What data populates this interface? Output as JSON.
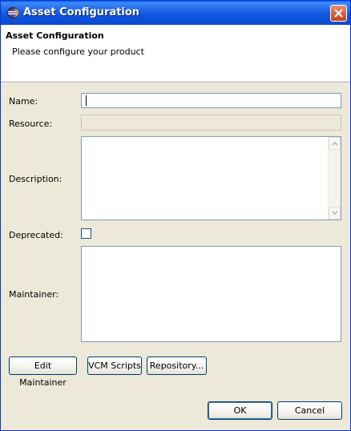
{
  "window": {
    "title": "Asset Configuration",
    "app_icon": "eclipse-icon",
    "close_icon": "close-icon"
  },
  "header": {
    "title": "Asset Configuration",
    "description": "Please configure your product"
  },
  "form": {
    "name_label": "Name:",
    "name_value": "",
    "resource_label": "Resource:",
    "resource_value": "",
    "description_label": "Description:",
    "description_value": "",
    "deprecated_label": "Deprecated:",
    "deprecated_checked": false,
    "maintainer_label": "Maintainer:",
    "maintainer_value": ""
  },
  "actions": {
    "edit_maintainer": "Edit Maintainer",
    "vcm_scripts": "VCM Scripts",
    "repository": "Repository..."
  },
  "footer": {
    "ok": "OK",
    "cancel": "Cancel"
  }
}
